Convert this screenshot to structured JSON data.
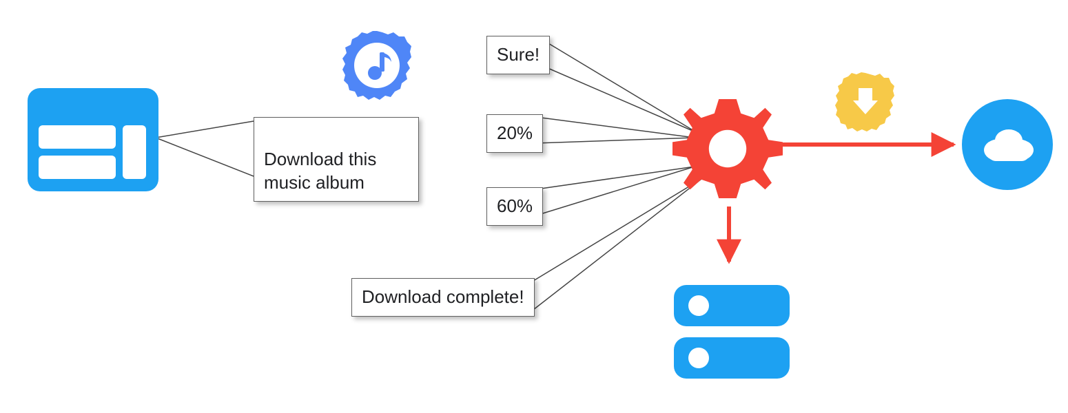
{
  "colors": {
    "blue": "#1DA1F2",
    "darkBlue": "#4F86F7",
    "red": "#F44336",
    "yellow": "#F7C948",
    "border": "#555555",
    "white": "#FFFFFF"
  },
  "bubbles": {
    "request": "Download this\nmusic album",
    "reply0": "Sure!",
    "reply1": "20%",
    "reply2": "60%",
    "reply3": "Download complete!"
  },
  "icons": {
    "client": "client-window-icon",
    "music": "music-note-badge-icon",
    "gear": "gear-icon",
    "download": "download-arrow-badge-icon",
    "cloud": "cloud-icon",
    "disk": "disk-stack-icon"
  }
}
